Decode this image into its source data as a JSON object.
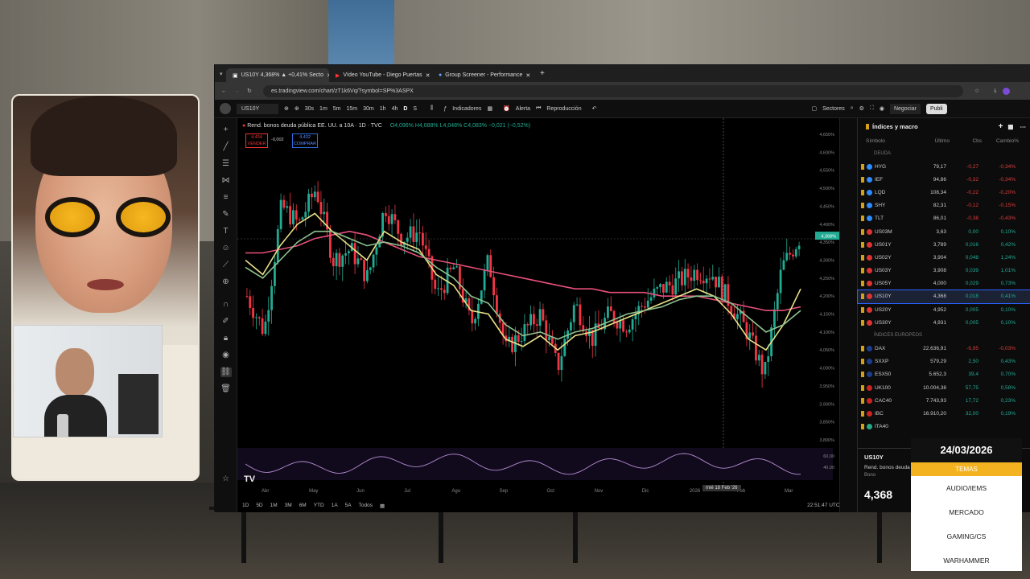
{
  "browser": {
    "tabs": [
      {
        "label": "US10Y 4,368% ▲ +0,41% Secto"
      },
      {
        "label": "Vídeo YouTube - Diego Puertas"
      },
      {
        "label": "Group Screener - Performance"
      }
    ],
    "url": "es.tradingview.com/chart/zT1k6Vq/?symbol=SP%3ASPX"
  },
  "toolbar": {
    "symbol": "US10Y",
    "intervals": [
      "30s",
      "1m",
      "5m",
      "15m",
      "30m",
      "1h",
      "4h",
      "D",
      "S"
    ],
    "indicators": "Indicadores",
    "alert": "Alerta",
    "replay": "Reproducción",
    "sectors": "Sectores",
    "trade": "Negociar",
    "publish": "Publi"
  },
  "chart": {
    "legend": "Rend. bonos deuda pública EE. UU. a 10A · 1D · TVC",
    "ohlc": "O4,096% H4,088% L4,048% C4,083% −0,021 (−0,52%)",
    "sell_price": "4,434",
    "sell_label": "VENDER",
    "spread": "-0,002",
    "buy_price": "4,432",
    "buy_label": "COMPRAR",
    "cursor_label": "mié 18 Feb '26",
    "timeframes": [
      "1D",
      "5D",
      "1M",
      "3M",
      "6M",
      "YTD",
      "1A",
      "5A",
      "Todos"
    ],
    "clock": "22:51:47 UTC+1"
  },
  "chart_data": {
    "type": "line",
    "title": "Rend. bonos deuda pública EE. UU. a 10A",
    "x": [
      "Abr",
      "May",
      "Jun",
      "Jul",
      "Ago",
      "Sep",
      "Oct",
      "Nov",
      "Dic",
      "2026",
      "Feb",
      "Mar"
    ],
    "y_ticks": [
      "4,650%",
      "4,600%",
      "4,550%",
      "4,500%",
      "4,450%",
      "4,400%",
      "4,350%",
      "4,300%",
      "4,250%",
      "4,200%",
      "4,150%",
      "4,100%",
      "4,050%",
      "4,000%",
      "3,950%",
      "3,900%",
      "3,850%",
      "3,800%"
    ],
    "ylim": [
      3.8,
      4.65
    ],
    "last_price": "4,368%",
    "series": [
      {
        "name": "US10Y",
        "color": "#22ab94",
        "values": [
          4.2,
          4.1,
          4.45,
          4.4,
          4.5,
          4.3,
          4.33,
          4.25,
          4.45,
          4.36,
          4.38,
          4.2,
          4.28,
          4.12,
          4.3,
          4.05,
          4.1,
          4.15,
          4.0,
          4.18,
          4.08,
          4.15,
          4.12,
          4.18,
          4.22,
          4.24,
          4.27,
          4.26,
          4.18,
          4.1,
          3.98,
          4.28,
          4.36
        ]
      },
      {
        "color": "#e8507a",
        "values": [
          4.32,
          4.32,
          4.33,
          4.34,
          4.36,
          4.37,
          4.38,
          4.37,
          4.35,
          4.33,
          4.31,
          4.3,
          4.29,
          4.28,
          4.27,
          4.26,
          4.25,
          4.24,
          4.23,
          4.22,
          4.22,
          4.21,
          4.21,
          4.21,
          4.2,
          4.2,
          4.2,
          4.19,
          4.18,
          4.17,
          4.16,
          4.16,
          4.17
        ]
      },
      {
        "color": "#e9e088",
        "values": [
          4.3,
          4.26,
          4.34,
          4.4,
          4.43,
          4.38,
          4.34,
          4.3,
          4.38,
          4.35,
          4.33,
          4.26,
          4.23,
          4.16,
          4.15,
          4.08,
          4.06,
          4.09,
          4.05,
          4.09,
          4.1,
          4.12,
          4.14,
          4.16,
          4.18,
          4.2,
          4.22,
          4.2,
          4.15,
          4.08,
          4.05,
          4.12,
          4.22
        ]
      },
      {
        "color": "#8fc28f",
        "values": [
          4.28,
          4.25,
          4.3,
          4.35,
          4.38,
          4.38,
          4.36,
          4.34,
          4.35,
          4.34,
          4.32,
          4.28,
          4.25,
          4.2,
          4.18,
          4.12,
          4.09,
          4.1,
          4.08,
          4.1,
          4.11,
          4.13,
          4.15,
          4.16,
          4.17,
          4.19,
          4.2,
          4.2,
          4.18,
          4.14,
          4.1,
          4.12,
          4.16
        ]
      }
    ]
  },
  "oscillator": {
    "ticks": [
      "60,00",
      "40,00"
    ]
  },
  "watchlist": {
    "title": "Índices y macro",
    "cols": [
      "Símbolo",
      "Último",
      "Cbs",
      "Cambio%"
    ],
    "section1": "DEUDA",
    "rows1": [
      {
        "sym": "HYG",
        "last": "79,17",
        "chg": "-0,27",
        "pct": "-0,34%",
        "up": false,
        "color": "#2d8cff"
      },
      {
        "sym": "IEF",
        "last": "94,86",
        "chg": "-0,32",
        "pct": "-0,34%",
        "up": false,
        "color": "#2d8cff"
      },
      {
        "sym": "LQD",
        "last": "108,34",
        "chg": "-0,22",
        "pct": "-0,20%",
        "up": false,
        "color": "#2d8cff"
      },
      {
        "sym": "SHY",
        "last": "82,31",
        "chg": "-0,12",
        "pct": "-0,15%",
        "up": false,
        "color": "#2d8cff"
      },
      {
        "sym": "TLT",
        "last": "86,01",
        "chg": "-0,38",
        "pct": "-0,43%",
        "up": false,
        "color": "#2d8cff"
      },
      {
        "sym": "US03M",
        "last": "3,63",
        "chg": "0,00",
        "pct": "0,10%",
        "up": true,
        "color": "#d33"
      },
      {
        "sym": "US01Y",
        "last": "3,789",
        "chg": "0,016",
        "pct": "0,42%",
        "up": true,
        "color": "#d33"
      },
      {
        "sym": "US02Y",
        "last": "3,904",
        "chg": "0,048",
        "pct": "1,24%",
        "up": true,
        "color": "#d33"
      },
      {
        "sym": "US03Y",
        "last": "3,908",
        "chg": "0,039",
        "pct": "1,01%",
        "up": true,
        "color": "#d33"
      },
      {
        "sym": "US05Y",
        "last": "4,000",
        "chg": "0,029",
        "pct": "0,73%",
        "up": true,
        "color": "#d33"
      },
      {
        "sym": "US10Y",
        "last": "4,368",
        "chg": "0,018",
        "pct": "0,41%",
        "up": true,
        "color": "#d33"
      },
      {
        "sym": "US20Y",
        "last": "4,952",
        "chg": "0,005",
        "pct": "0,10%",
        "up": true,
        "color": "#d33"
      },
      {
        "sym": "US30Y",
        "last": "4,931",
        "chg": "0,005",
        "pct": "0,10%",
        "up": true,
        "color": "#d33"
      }
    ],
    "section2": "ÍNDICES EUROPEOS",
    "rows2": [
      {
        "sym": "DAX",
        "last": "22.636,91",
        "chg": "-6,95",
        "pct": "-0,03%",
        "up": false,
        "color": "#1a3d8f"
      },
      {
        "sym": "SXXP",
        "last": "579,29",
        "chg": "2,50",
        "pct": "0,43%",
        "up": true,
        "color": "#1a3d8f"
      },
      {
        "sym": "ESX50",
        "last": "5.652,3",
        "chg": "39,4",
        "pct": "0,70%",
        "up": true,
        "color": "#1a3d8f"
      },
      {
        "sym": "UK100",
        "last": "10.004,38",
        "chg": "57,75",
        "pct": "0,58%",
        "up": true,
        "color": "#c22"
      },
      {
        "sym": "CAC40",
        "last": "7.743,93",
        "chg": "17,72",
        "pct": "0,23%",
        "up": true,
        "color": "#c22"
      },
      {
        "sym": "IBC",
        "last": "16.910,20",
        "chg": "32,00",
        "pct": "0,19%",
        "up": true,
        "color": "#c22"
      },
      {
        "sym": "ITA40",
        "last": "",
        "chg": "",
        "pct": "",
        "up": true,
        "color": "#2a8"
      }
    ],
    "detail_sym": "US10Y",
    "detail_name": "Rend. bonos deuda",
    "detail_sub": "Bono",
    "detail_price": "4,368"
  },
  "overlay": {
    "date": "24/03/2026",
    "header": "TEMAS",
    "topics": [
      "AUDIO/IEMS",
      "MERCADO",
      "GAMING/CS",
      "WARHAMMER"
    ]
  }
}
